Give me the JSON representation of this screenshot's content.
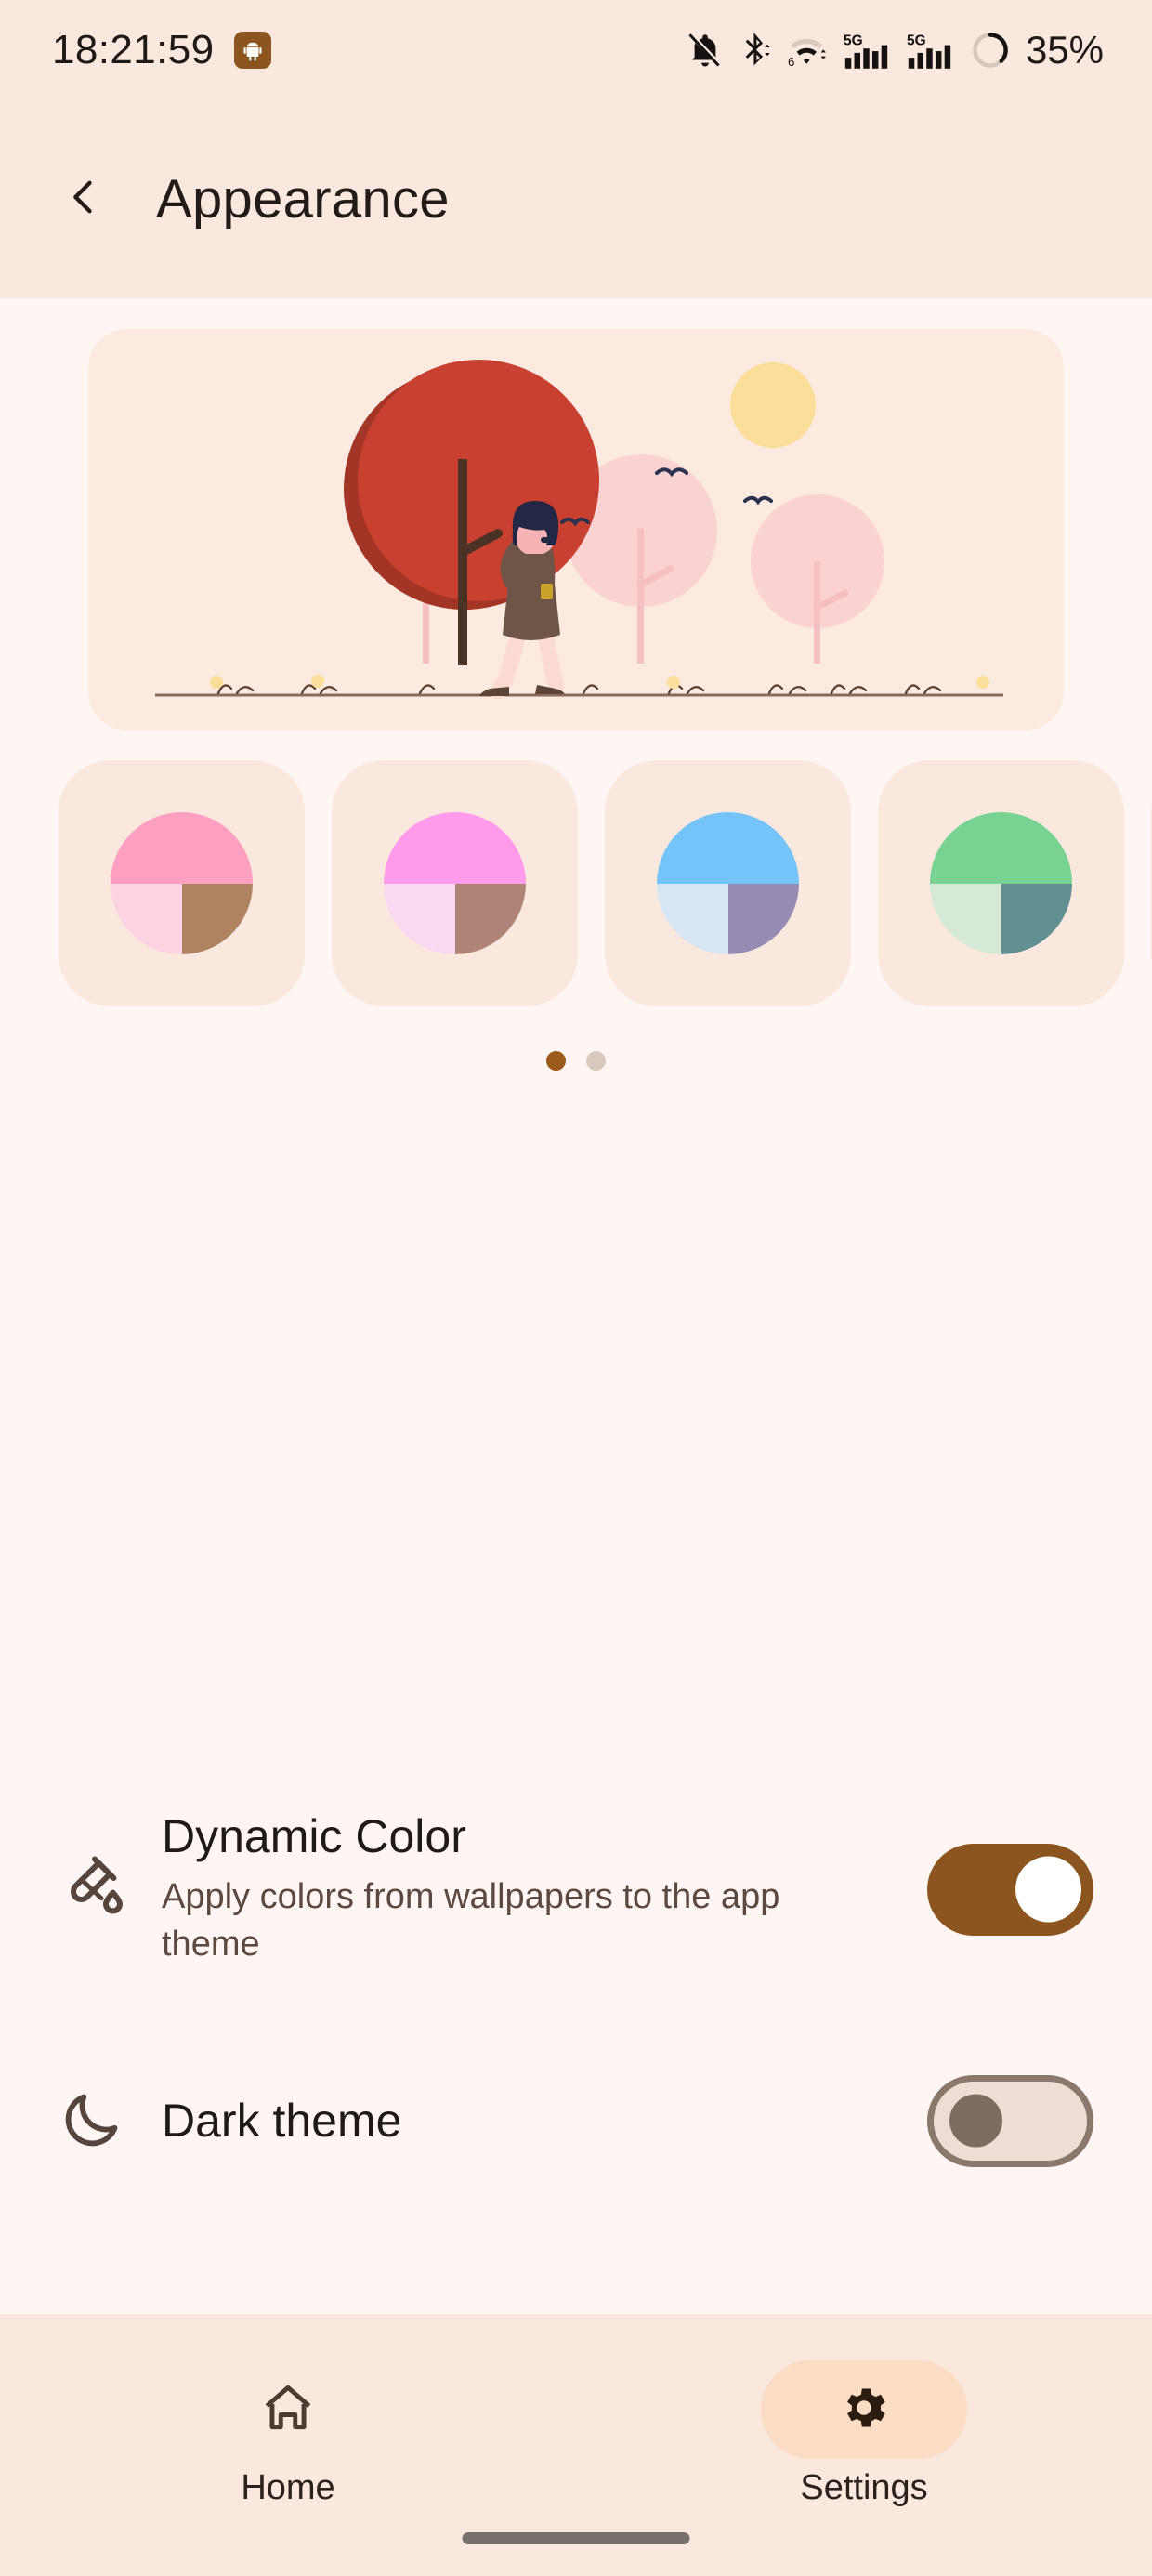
{
  "status_bar": {
    "time": "18:21:59",
    "app_badge_icon": "android-robot-icon",
    "icons": [
      "notifications-off-icon",
      "bluetooth-icon",
      "wifi-6-icon",
      "signal-5g-icon",
      "signal-5g-secondary-icon",
      "battery-ring-icon"
    ],
    "battery_percent": "35%"
  },
  "app_bar": {
    "back_icon": "chevron-left-icon",
    "title": "Appearance"
  },
  "hero": {
    "illustration_name": "woman-walking-in-park-illustration",
    "card_bg": "#FCEAE0",
    "colors": {
      "red_tree": "#C8402F",
      "red_tree_shadow": "#A33527",
      "pink_tree": "#FAD2D2",
      "trunk": "#4A3227",
      "pink_trunk": "#F7C0C0",
      "sun": "#FADE9A",
      "bird": "#2C3150",
      "hair": "#222845",
      "face": "#F7B3B3",
      "coat": "#6E5548",
      "legs": "#FBDAD4",
      "shoes": "#5C4436",
      "cup": "#C9A227",
      "ground": "#8A6A5C"
    }
  },
  "themes": {
    "swatches": [
      {
        "name": "theme-swatch-pink",
        "top": "#FD9FC0",
        "bottom_left": "#FDD3E1",
        "bottom_right": "#AF8262"
      },
      {
        "name": "theme-swatch-magenta",
        "top": "#FF9BEA",
        "bottom_left": "#F9D9F2",
        "bottom_right": "#B08377"
      },
      {
        "name": "theme-swatch-blue",
        "top": "#74C4FA",
        "bottom_left": "#D6E6F4",
        "bottom_right": "#968BB2"
      },
      {
        "name": "theme-swatch-green",
        "top": "#78D392",
        "bottom_left": "#D6E9D6",
        "bottom_right": "#628F92"
      },
      {
        "name": "theme-swatch-partial",
        "top": "#FAE7DD",
        "bottom_left": "#FAE7DD",
        "bottom_right": "#FAE7DD"
      }
    ],
    "card_bg": "#FAE7DD",
    "page_dots": [
      {
        "name": "page-dot-active",
        "active": true,
        "color": "#9C5B1C"
      },
      {
        "name": "page-dot-inactive",
        "active": false,
        "color": "#D8C9BF"
      }
    ]
  },
  "settings": {
    "dynamic_color": {
      "icon": "test-tube-colorize-icon",
      "title": "Dynamic Color",
      "subtitle": "Apply colors from wallpapers to the app theme",
      "toggle_state": "on",
      "toggle_on_color": "#8C5520",
      "toggle_thumb_color": "#FFFFFF"
    },
    "dark_theme": {
      "icon": "moon-crescent-icon",
      "title": "Dark theme",
      "toggle_state": "off",
      "toggle_off_track": "#EDDDD4",
      "toggle_off_border": "#8A786D",
      "toggle_off_thumb": "#7D6C61"
    }
  },
  "bottom_nav": {
    "items": [
      {
        "name": "nav-item-home",
        "icon": "home-icon",
        "label": "Home",
        "active": false
      },
      {
        "name": "nav-item-settings",
        "icon": "gear-icon",
        "label": "Settings",
        "active": true
      }
    ],
    "active_pill_color": "#FBDCC4",
    "gesture_bar": "home-gesture-bar"
  }
}
